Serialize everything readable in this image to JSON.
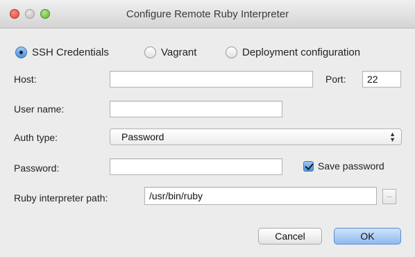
{
  "window": {
    "title": "Configure Remote Ruby Interpreter"
  },
  "connection_type": {
    "options": [
      "SSH Credentials",
      "Vagrant",
      "Deployment configuration"
    ],
    "selected": "SSH Credentials"
  },
  "form": {
    "host": {
      "label": "Host:",
      "value": ""
    },
    "port": {
      "label": "Port:",
      "value": "22"
    },
    "username": {
      "label": "User name:",
      "value": ""
    },
    "auth_type": {
      "label": "Auth type:",
      "value": "Password"
    },
    "password": {
      "label": "Password:",
      "value": ""
    },
    "save_password": {
      "label": "Save password",
      "checked": true
    },
    "interpreter_path": {
      "label": "Ruby interpreter path:",
      "value": "/usr/bin/ruby",
      "browse_label": "..."
    }
  },
  "buttons": {
    "cancel": "Cancel",
    "ok": "OK"
  },
  "colors": {
    "accent": "#4e92dd",
    "window_bg": "#ececec"
  }
}
